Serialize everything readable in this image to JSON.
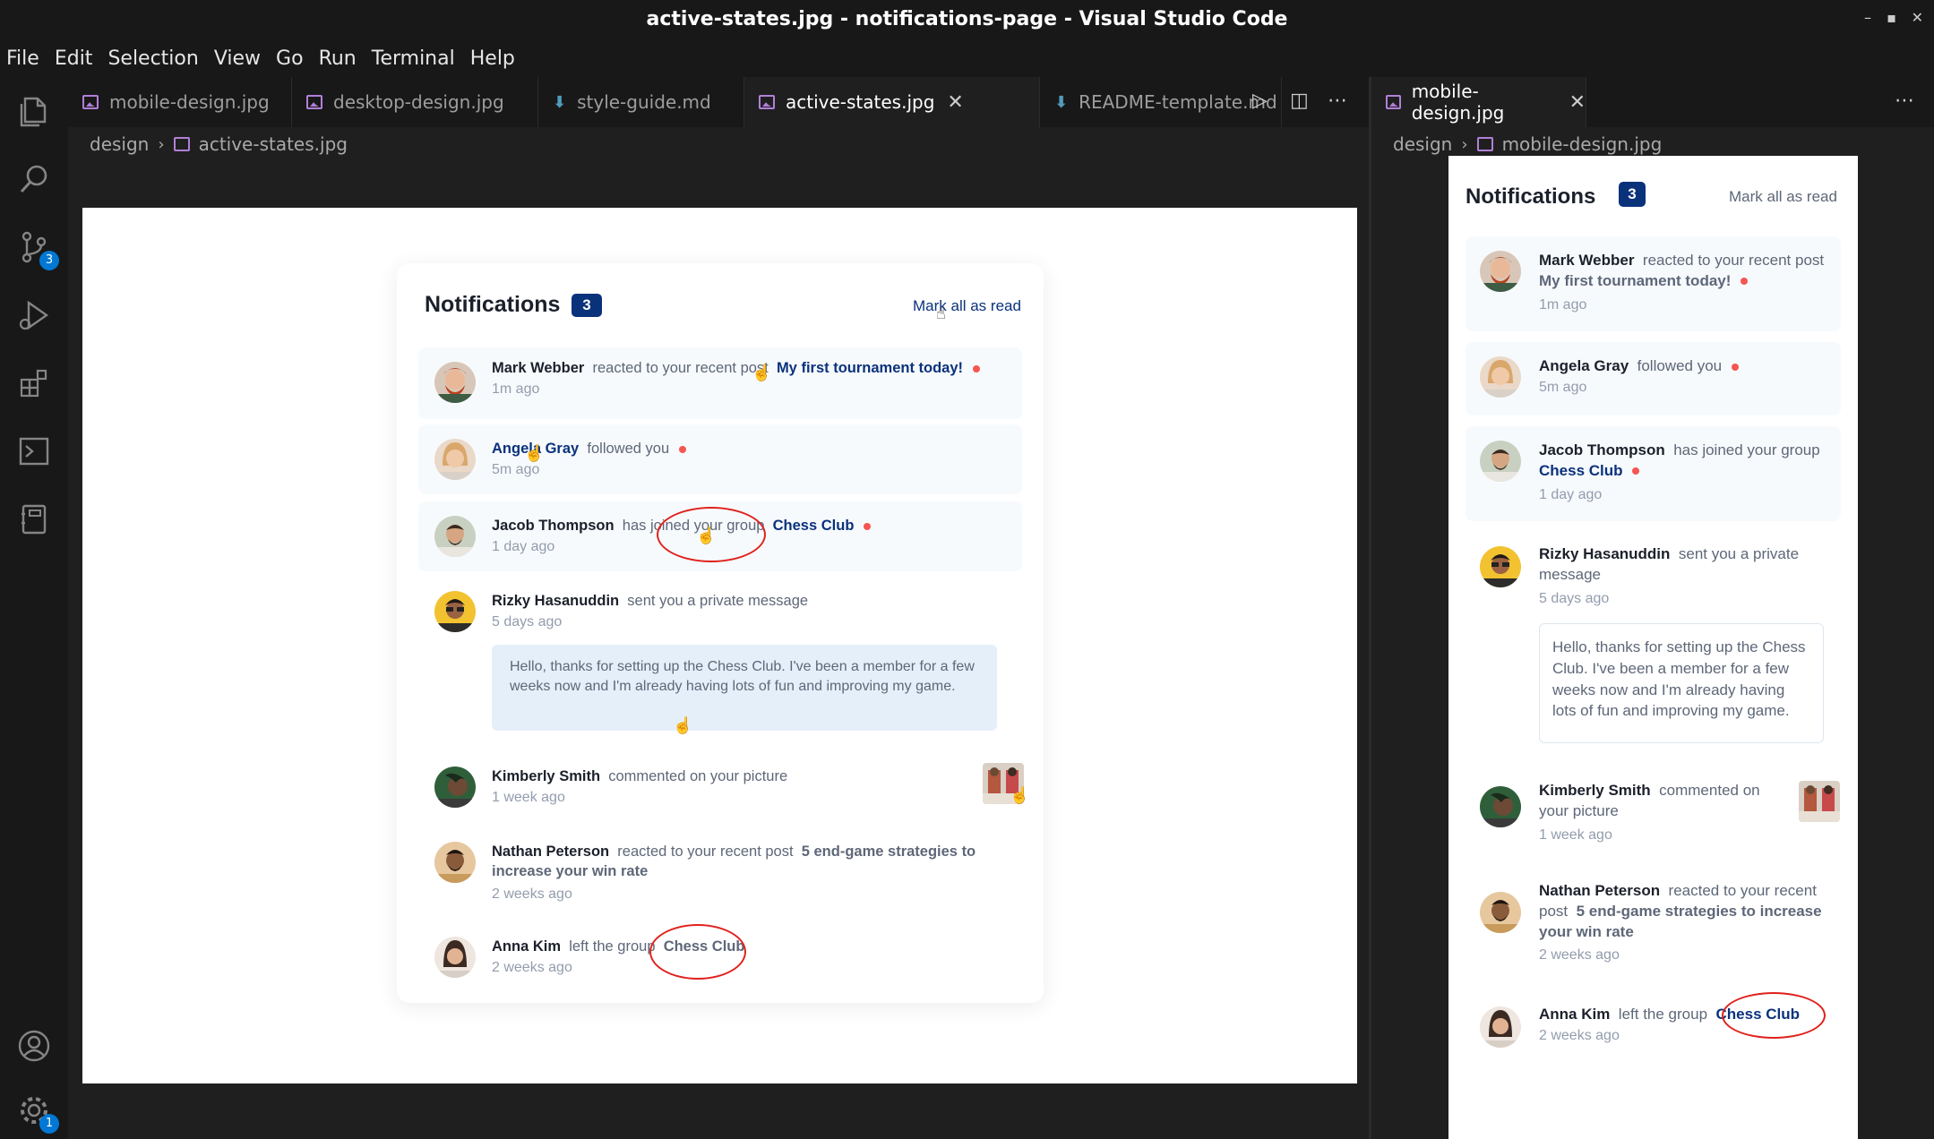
{
  "window": {
    "title": "active-states.jpg - notifications-page - Visual Studio Code"
  },
  "menu": [
    "File",
    "Edit",
    "Selection",
    "View",
    "Go",
    "Run",
    "Terminal",
    "Help"
  ],
  "activity_bar": {
    "source_control_badge": "3",
    "settings_badge": "1"
  },
  "left_group": {
    "tabs": [
      {
        "label": "mobile-design.jpg",
        "type": "image"
      },
      {
        "label": "desktop-design.jpg",
        "type": "image"
      },
      {
        "label": "style-guide.md",
        "type": "markdown"
      },
      {
        "label": "active-states.jpg",
        "type": "image",
        "active": true
      },
      {
        "label": "README-template.md",
        "type": "markdown"
      }
    ],
    "breadcrumb": {
      "folder": "design",
      "file": "active-states.jpg"
    }
  },
  "right_group": {
    "tabs": [
      {
        "label": "mobile-design.jpg",
        "type": "image",
        "active": true
      }
    ],
    "breadcrumb": {
      "folder": "design",
      "file": "mobile-design.jpg"
    }
  },
  "notifications": {
    "title": "Notifications",
    "count": "3",
    "mark_all": "Mark all as read",
    "items": [
      {
        "name": "Mark Webber",
        "action": "reacted to your recent post",
        "post": "My first tournament today!",
        "time": "1m ago",
        "unread": true
      },
      {
        "name": "Angela Gray",
        "action": "followed you",
        "time": "5m ago",
        "unread": true
      },
      {
        "name": "Jacob Thompson",
        "action": "has joined your group",
        "group": "Chess Club",
        "time": "1 day ago",
        "unread": true
      },
      {
        "name": "Rizky Hasanuddin",
        "action": "sent you a private message",
        "time": "5 days ago",
        "message": "Hello, thanks for setting up the Chess Club. I've been a member for a few weeks now and I'm already having lots of fun and improving my game."
      },
      {
        "name": "Kimberly Smith",
        "action": "commented on your picture",
        "time": "1 week ago"
      },
      {
        "name": "Nathan Peterson",
        "action": "reacted to your recent post",
        "post": "5 end-game strategies to increase your win rate",
        "time": "2 weeks ago"
      },
      {
        "name": "Anna Kim",
        "action": "left the group",
        "group": "Chess Club",
        "time": "2 weeks ago"
      }
    ]
  },
  "colors": {
    "navy": "#0a327b",
    "red_dot": "#f65552",
    "unread_bg": "#f7fafd",
    "annotation_red": "#e0221d"
  }
}
